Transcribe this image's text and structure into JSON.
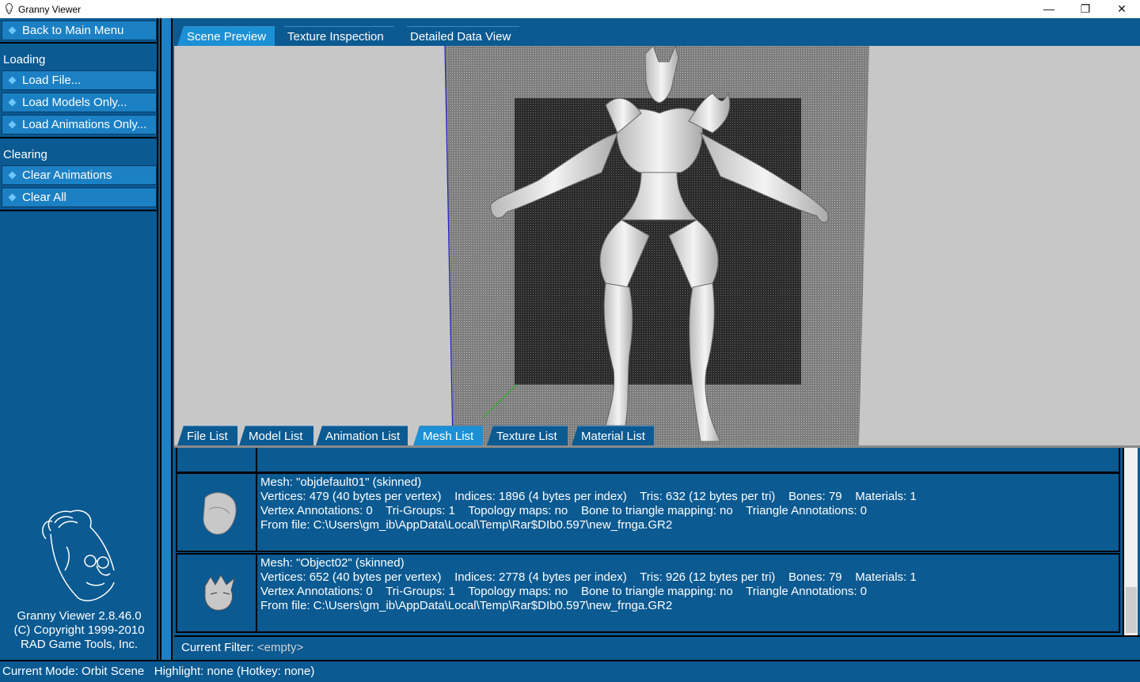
{
  "window": {
    "title": "Granny Viewer",
    "minimize": "—",
    "maximize": "❐",
    "close": "✕"
  },
  "sidebar": {
    "back": "Back to Main Menu",
    "loading_header": "Loading",
    "loading": [
      "Load File...",
      "Load Models Only...",
      "Load Animations Only..."
    ],
    "clearing_header": "Clearing",
    "clearing": [
      "Clear Animations",
      "Clear All"
    ],
    "about": [
      "Granny Viewer 2.8.46.0",
      "(C) Copyright 1999-2010",
      "RAD Game Tools, Inc."
    ]
  },
  "top_tabs": [
    {
      "label": "Scene Preview",
      "active": true
    },
    {
      "label": "Texture Inspection",
      "active": false
    },
    {
      "label": "Detailed Data View",
      "active": false
    }
  ],
  "bottom_tabs": [
    {
      "label": "File List",
      "active": false
    },
    {
      "label": "Model List",
      "active": false
    },
    {
      "label": "Animation List",
      "active": false
    },
    {
      "label": "Mesh List",
      "active": true
    },
    {
      "label": "Texture List",
      "active": false
    },
    {
      "label": "Material List",
      "active": false
    }
  ],
  "meshes": [
    {
      "name": "Mesh: \"objdefault01\" (skinned)",
      "line2": "Vertices: 479 (40 bytes per vertex)    Indices: 1896 (4 bytes per index)    Tris: 632 (12 bytes per tri)    Bones: 79    Materials: 1",
      "line3": "Vertex Annotations: 0    Tri-Groups: 1    Topology maps: no    Bone to triangle mapping: no    Triangle Annotations: 0",
      "line4": "From file: C:\\Users\\gm_ib\\AppData\\Local\\Temp\\Rar$DIb0.597\\new_frnga.GR2"
    },
    {
      "name": "Mesh: \"Object02\" (skinned)",
      "line2": "Vertices: 652 (40 bytes per vertex)    Indices: 2778 (4 bytes per index)    Tris: 926 (12 bytes per tri)    Bones: 79    Materials: 1",
      "line3": "Vertex Annotations: 0    Tri-Groups: 1    Topology maps: no    Bone to triangle mapping: no    Triangle Annotations: 0",
      "line4": "From file: C:\\Users\\gm_ib\\AppData\\Local\\Temp\\Rar$DIb0.597\\new_frnga.GR2"
    }
  ],
  "filter": {
    "label": "Current Filter: ",
    "value": "<empty>"
  },
  "status": "Current Mode: Orbit Scene   Highlight: none (Hotkey: none)"
}
